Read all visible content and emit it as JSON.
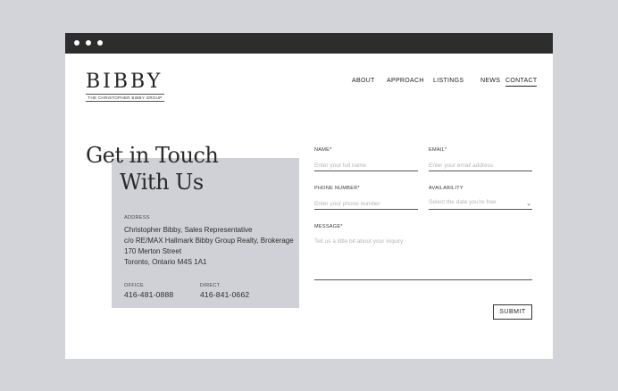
{
  "brand": {
    "name": "BIBBY",
    "tagline": "THE CHRISTOPHER BIBBY GROUP"
  },
  "nav": [
    {
      "label": "ABOUT"
    },
    {
      "label": "APPROACH"
    },
    {
      "label": "LISTINGS"
    },
    {
      "label": "NEWS"
    },
    {
      "label": "CONTACT",
      "active": true
    }
  ],
  "hero": {
    "line1": "Get in Touch",
    "line2": "With Us"
  },
  "contact": {
    "address_label": "ADDRESS",
    "address_lines": [
      "Christopher Bibby, Sales Representative",
      "c/o RE/MAX Hallmark Bibby Group Realty, Brokerage",
      "170 Merton Street",
      "Toronto, Ontario M4S 1A1"
    ],
    "office_label": "OFFICE",
    "office_phone": "416-481-0888",
    "direct_label": "DIRECT",
    "direct_phone": "416-841-0662"
  },
  "form": {
    "name": {
      "label": "NAME*",
      "placeholder": "Enter your full name",
      "value": ""
    },
    "email": {
      "label": "EMAIL*",
      "placeholder": "Enter your email address",
      "value": ""
    },
    "phone": {
      "label": "PHONE NUMBER*",
      "placeholder": "Enter your phone number",
      "value": ""
    },
    "availability": {
      "label": "AVAILABILITY",
      "placeholder": "Select the date you're free"
    },
    "message": {
      "label": "MESSAGE*",
      "placeholder": "Tell us a little bit about your inquiry",
      "value": ""
    },
    "submit_label": "SUBMIT"
  },
  "icons": {
    "window_controls": [
      "window-dot-icon",
      "window-dot-icon",
      "window-dot-icon"
    ],
    "select_chevron": "chevron-down-icon"
  },
  "colors": {
    "background": "#d3d4d9",
    "titlebar": "#2d2d2d",
    "panel": "#d0d1d6",
    "text": "#2b2b2b",
    "placeholder": "#b5b5b5"
  }
}
